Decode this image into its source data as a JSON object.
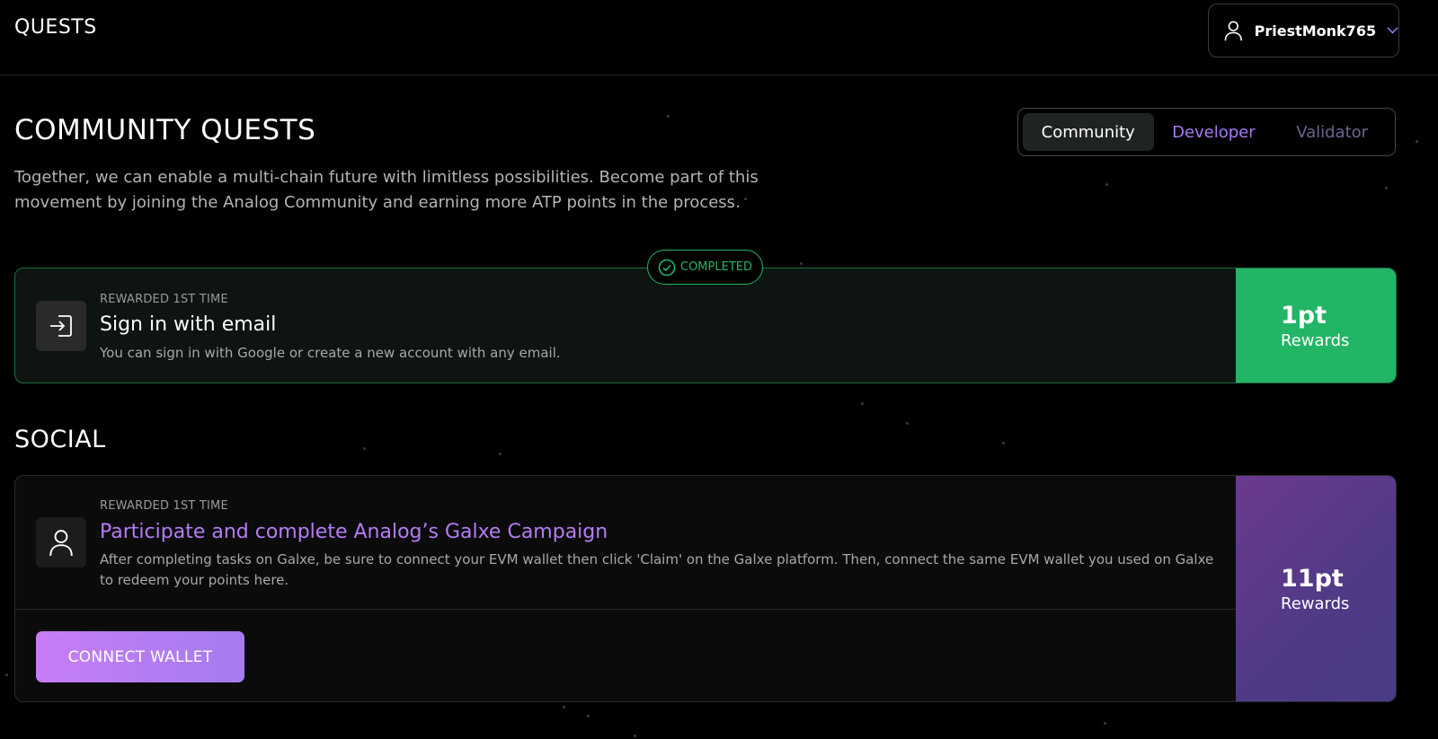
{
  "header": {
    "title": "QUESTS",
    "username": "PriestMonk765"
  },
  "community": {
    "title": "COMMUNITY QUESTS",
    "description": "Together, we can enable a multi-chain future with limitless possibilities. Become part of this movement by joining the Analog Community and earning more ATP points in the process.",
    "tabs": [
      {
        "label": "Community",
        "selected": true
      },
      {
        "label": "Developer",
        "selected": false
      },
      {
        "label": "Validator",
        "selected": false
      }
    ]
  },
  "quests": {
    "email": {
      "badge": "COMPLETED",
      "eyebrow": "REWARDED 1ST TIME",
      "title": "Sign in with email",
      "description": "You can sign in with Google or create a new account with any email.",
      "points": "1pt",
      "reward_label": "Rewards",
      "icon": "sign-in-icon"
    },
    "galxe": {
      "eyebrow": "REWARDED 1ST TIME",
      "title": "Participate and complete Analog’s Galxe Campaign",
      "description": "After completing tasks on Galxe, be sure to connect your EVM wallet then click 'Claim' on the Galxe platform. Then, connect the same EVM wallet you used on Galxe to redeem your points here.",
      "button": "CONNECT WALLET",
      "points": "11pt",
      "reward_label": "Rewards",
      "icon": "user-icon"
    }
  },
  "social": {
    "title": "SOCIAL"
  },
  "colors": {
    "accent_green": "#22b566",
    "accent_purple": "#a87af2",
    "background": "#000000"
  }
}
